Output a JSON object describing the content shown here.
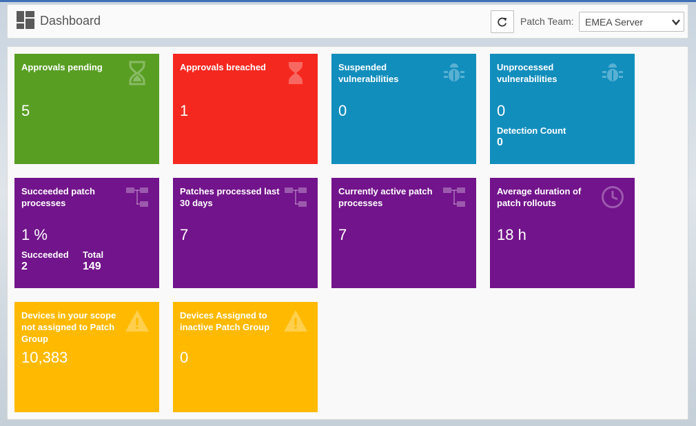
{
  "header": {
    "title": "Dashboard",
    "patch_team_label": "Patch Team:",
    "patch_team_value": "EMEA Server"
  },
  "colors": {
    "green": "#589e23",
    "red": "#f5281f",
    "blue": "#128ebd",
    "purple": "#72148b",
    "amber": "#ffba00"
  },
  "tiles": [
    {
      "label": "Approvals pending",
      "value": "5",
      "icon": "hourglass-icon"
    },
    {
      "label": "Approvals breached",
      "value": "1",
      "icon": "hourglass-icon"
    },
    {
      "label": "Suspended vulnerabilities",
      "value": "0",
      "icon": "bug-icon"
    },
    {
      "label": "Unprocessed vulnerabilities",
      "value": "0",
      "icon": "bug-icon",
      "sub": {
        "label": "Detection Count",
        "value": "0"
      }
    },
    {
      "label": "Succeeded patch processes",
      "value": "1 %",
      "icon": "sitemap-icon",
      "sub": {
        "succeeded_label": "Succeeded",
        "succeeded_value": "2",
        "total_label": "Total",
        "total_value": "149"
      }
    },
    {
      "label": "Patches processed last 30 days",
      "value": "7",
      "icon": "sitemap-icon"
    },
    {
      "label": "Currently active patch processes",
      "value": "7",
      "icon": "sitemap-icon"
    },
    {
      "label": "Average duration of patch rollouts",
      "value": "18 h",
      "icon": "clock-icon"
    },
    {
      "label": "Devices in your scope not assigned to Patch Group",
      "value": "10,383",
      "icon": "warning-icon"
    },
    {
      "label": "Devices Assigned to inactive Patch Group",
      "value": "0",
      "icon": "warning-icon"
    }
  ]
}
